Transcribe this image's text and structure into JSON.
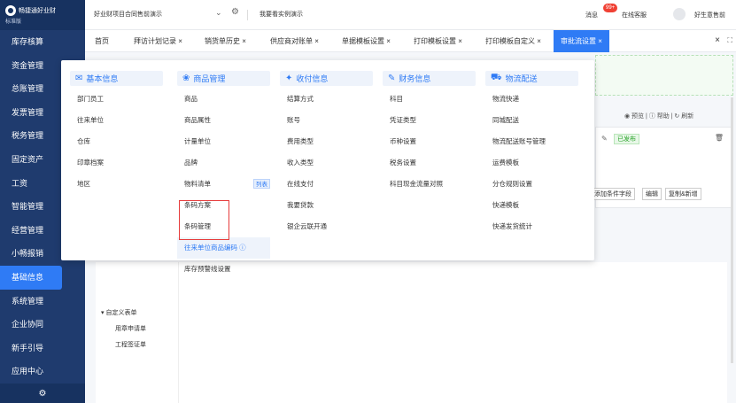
{
  "sidebar": {
    "logo_text": "畅捷通好业财",
    "logo_sub": "标准版",
    "items": [
      {
        "label": "库存核算"
      },
      {
        "label": "资金管理"
      },
      {
        "label": "总账管理"
      },
      {
        "label": "发票管理"
      },
      {
        "label": "税务管理"
      },
      {
        "label": "固定资产"
      },
      {
        "label": "工资"
      },
      {
        "label": "智能管理"
      },
      {
        "label": "经营管理"
      },
      {
        "label": "小畅报销"
      },
      {
        "label": "基础信息"
      },
      {
        "label": "系统管理"
      },
      {
        "label": "企业协同"
      },
      {
        "label": "新手引导"
      },
      {
        "label": "应用中心"
      }
    ],
    "settings_glyph": "⚙"
  },
  "topbar": {
    "account": "好业财项目合同售前演示",
    "chevron": "⌄",
    "gear_glyph": "⚙",
    "demo_link": "我要看实例演示",
    "messages_label": "消息",
    "messages_badge": "99+",
    "service_label": "在线客服",
    "user_name": "好生意售前"
  },
  "tabs": {
    "items": [
      {
        "label": "首页"
      },
      {
        "label": "拜访计划记录 ×"
      },
      {
        "label": "销货单历史 ×"
      },
      {
        "label": "供应商对账单 ×"
      },
      {
        "label": "单据模板设置 ×"
      },
      {
        "label": "打印模板设置 ×"
      },
      {
        "label": "打印模板自定义 ×"
      },
      {
        "label": "审批流设置 ×"
      }
    ],
    "close_all": "×",
    "expand": "⛶"
  },
  "background": {
    "preview_bar": "◉ 预览 | ⓘ 帮助 | ↻ 刷新",
    "published_badge": "已发布",
    "card_buttons": [
      "添加条件字段",
      "编辑",
      "复制&新增"
    ]
  },
  "tree": {
    "parent": "▾ 自定义表单",
    "children": [
      "用章申请单",
      "工程签证单"
    ]
  },
  "megamenu": {
    "columns": [
      {
        "title": "基本信息",
        "icon_glyph": "✉",
        "items": [
          "部门员工",
          "往来单位",
          "仓库",
          "印章档案",
          "地区"
        ]
      },
      {
        "title": "商品管理",
        "icon_glyph": "❀",
        "items": [
          "商品",
          "商品属性",
          "计量单位",
          "品牌",
          "物料清单",
          "条码方案",
          "条码管理",
          "往来单位商品编码 ⓘ",
          "库存预警线设置"
        ],
        "list_badge": "列表"
      },
      {
        "title": "收付信息",
        "icon_glyph": "✦",
        "items": [
          "结算方式",
          "账号",
          "费用类型",
          "收入类型",
          "在线支付",
          "我要贷款",
          "银企云联开通"
        ]
      },
      {
        "title": "财务信息",
        "icon_glyph": "✎",
        "items": [
          "科目",
          "凭证类型",
          "币种设置",
          "税务设置",
          "科目现金流量对照"
        ]
      },
      {
        "title": "物流配送",
        "icon_glyph": "⛟",
        "items": [
          "物流快递",
          "同城配送",
          "物流配送账号管理",
          "运费模板",
          "分仓规则设置",
          "快递模板",
          "快递发货统计"
        ]
      }
    ]
  }
}
